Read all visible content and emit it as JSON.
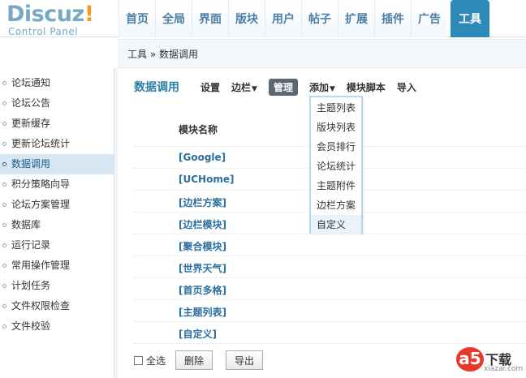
{
  "logo": {
    "main": "Discuz",
    "bang": "!",
    "sub": "Control Panel"
  },
  "nav": {
    "tabs": [
      "首页",
      "全局",
      "界面",
      "版块",
      "用户",
      "帖子",
      "扩展",
      "插件",
      "广告",
      "工具"
    ],
    "active": "工具"
  },
  "breadcrumb": "工具 » 数据调用",
  "sidebar": {
    "items": [
      "论坛通知",
      "论坛公告",
      "更新缓存",
      "更新论坛统计",
      "数据调用",
      "积分策略向导",
      "论坛方案管理",
      "数据库",
      "运行记录",
      "常用操作管理",
      "计划任务",
      "文件权限检查",
      "文件校验"
    ],
    "active": "数据调用"
  },
  "toolbar": {
    "title": "数据调用",
    "settings": "设置",
    "sidebar_menu": "边栏",
    "manage": "管理",
    "add": "添加",
    "module_script": "模块脚本",
    "import": "导入"
  },
  "table": {
    "header": "模块名称",
    "rows": [
      "[Google]",
      "[UCHome]",
      "[边栏方案]",
      "[边栏模块]",
      "[聚合模块]",
      "[世界天气]",
      "[首页多格]",
      "[主题列表]",
      "[自定义]"
    ]
  },
  "dropdown": {
    "items": [
      "主题列表",
      "版块列表",
      "会员排行",
      "论坛统计",
      "主题附件",
      "边栏方案",
      "自定义"
    ]
  },
  "footer": {
    "select_all": "全选",
    "delete": "删除",
    "export": "导出"
  },
  "watermark": {
    "text": "下载",
    "url": "xiazai.com",
    "mark": "a5"
  }
}
